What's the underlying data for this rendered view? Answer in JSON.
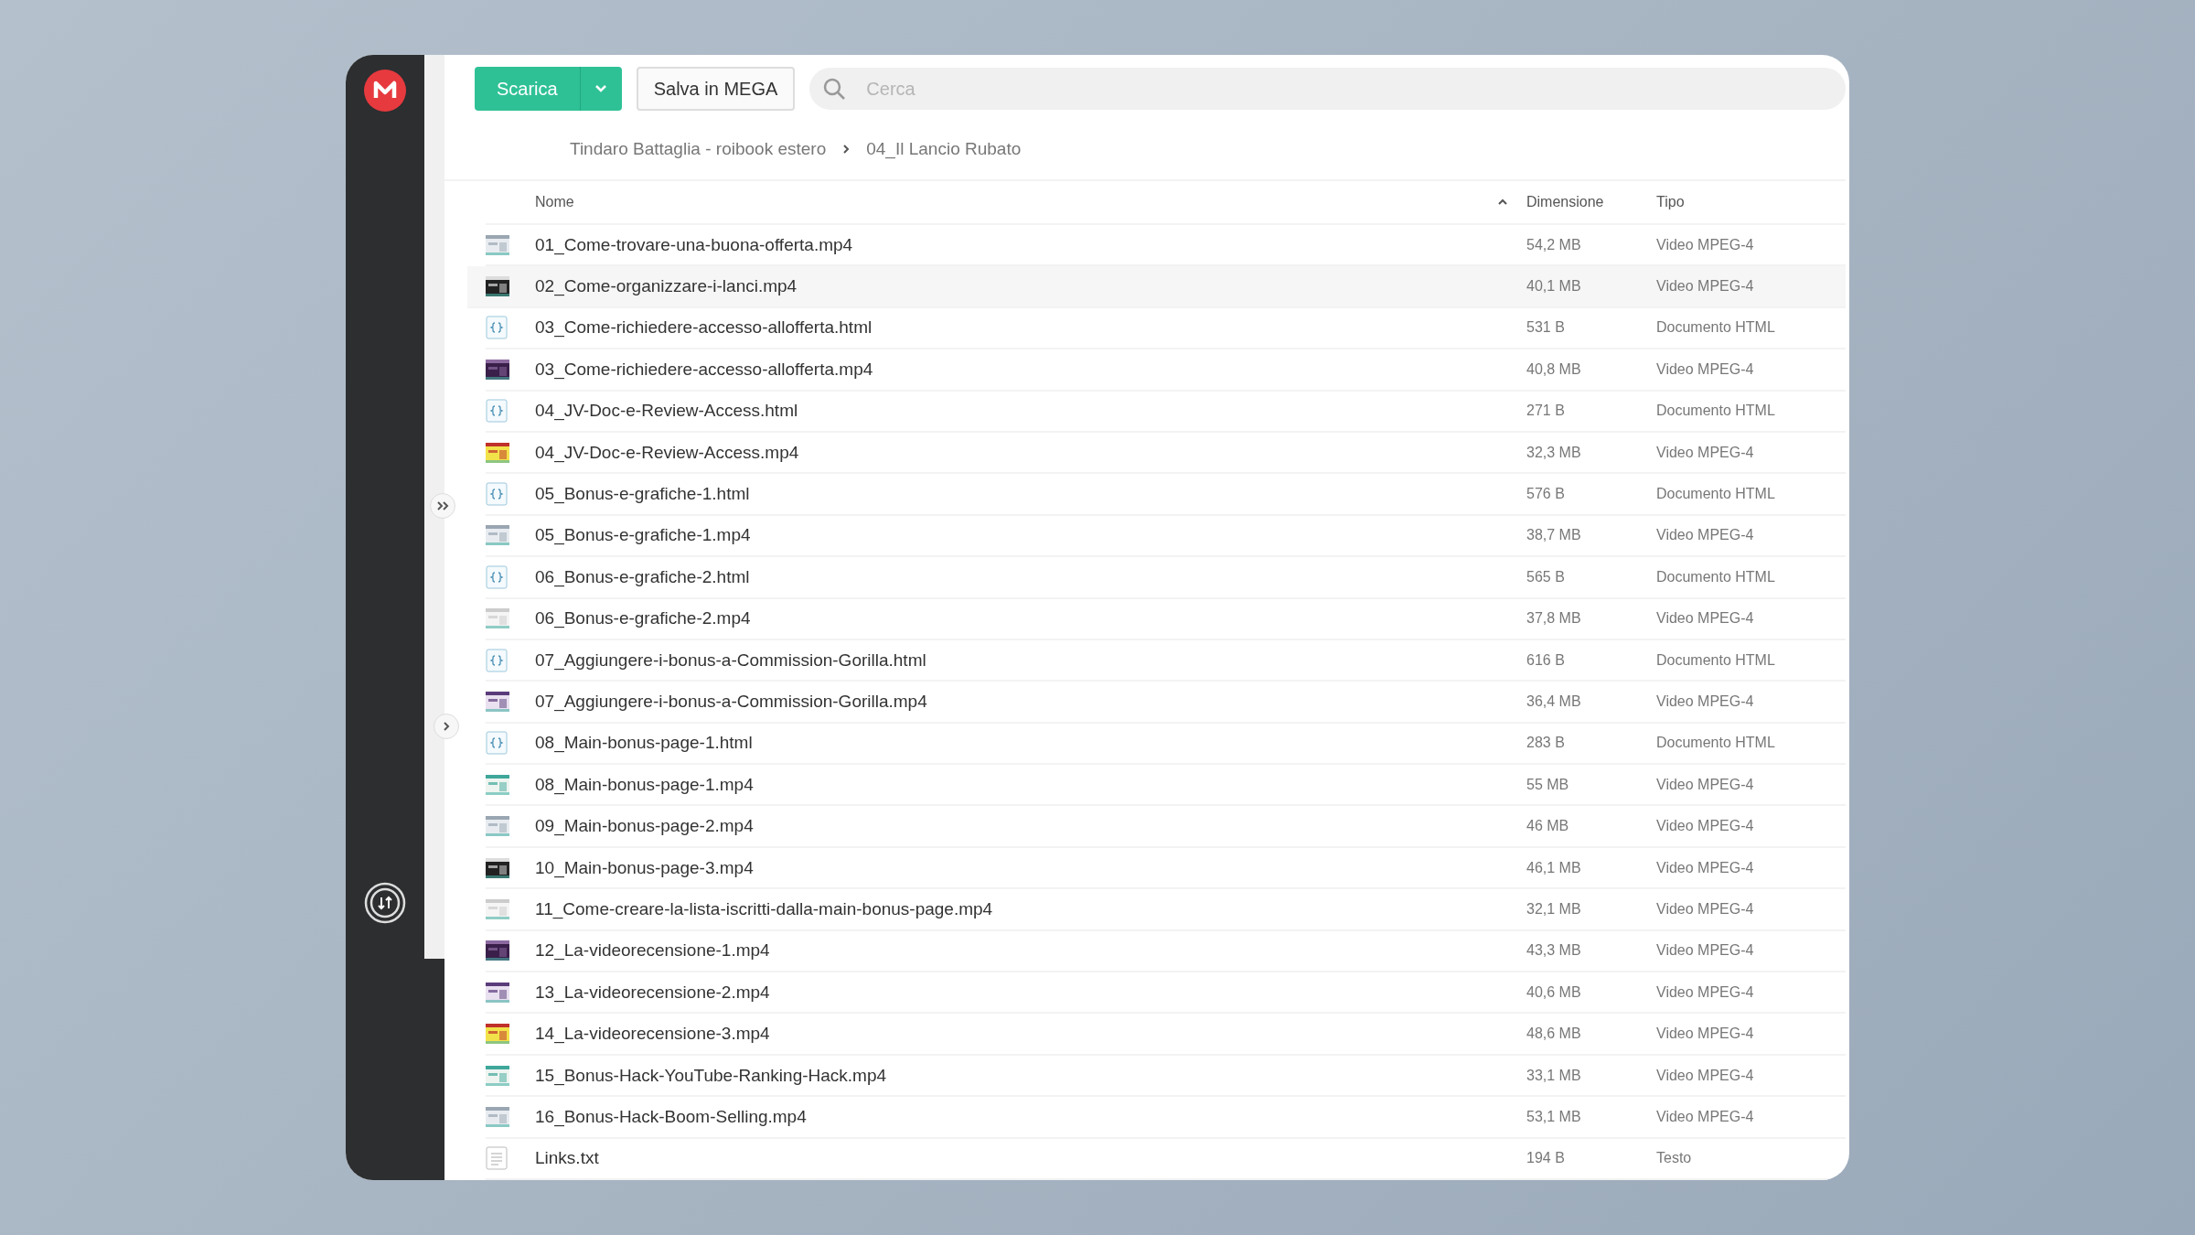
{
  "toolbar": {
    "download_button": "Scarica",
    "save_button": "Salva in MEGA",
    "search": {
      "placeholder": "Cerca"
    }
  },
  "breadcrumb": [
    "Tindaro Battaglia - roibook estero",
    "04_Il Lancio Rubato"
  ],
  "table": {
    "columns": [
      {
        "label": "Nome",
        "sorted": true
      },
      {
        "label": "Dimensione",
        "sorted": false
      },
      {
        "label": "Tipo",
        "sorted": false
      }
    ],
    "rows": [
      {
        "kind": "video",
        "name": "01_Come-trovare-una-buona-offerta.mp4",
        "size": "54,2 MB",
        "type": "Video MPEG-4",
        "selected": false
      },
      {
        "kind": "video",
        "name": "02_Come-organizzare-i-lanci.mp4",
        "size": "40,1 MB",
        "type": "Video MPEG-4",
        "selected": true
      },
      {
        "kind": "html",
        "name": "03_Come-richiedere-accesso-allofferta.html",
        "size": "531 B",
        "type": "Documento HTML",
        "selected": false
      },
      {
        "kind": "video",
        "name": "03_Come-richiedere-accesso-allofferta.mp4",
        "size": "40,8 MB",
        "type": "Video MPEG-4",
        "selected": false
      },
      {
        "kind": "html",
        "name": "04_JV-Doc-e-Review-Access.html",
        "size": "271 B",
        "type": "Documento HTML",
        "selected": false
      },
      {
        "kind": "video",
        "name": "04_JV-Doc-e-Review-Access.mp4",
        "size": "32,3 MB",
        "type": "Video MPEG-4",
        "selected": false
      },
      {
        "kind": "html",
        "name": "05_Bonus-e-grafiche-1.html",
        "size": "576 B",
        "type": "Documento HTML",
        "selected": false
      },
      {
        "kind": "video",
        "name": "05_Bonus-e-grafiche-1.mp4",
        "size": "38,7 MB",
        "type": "Video MPEG-4",
        "selected": false
      },
      {
        "kind": "html",
        "name": "06_Bonus-e-grafiche-2.html",
        "size": "565 B",
        "type": "Documento HTML",
        "selected": false
      },
      {
        "kind": "video",
        "name": "06_Bonus-e-grafiche-2.mp4",
        "size": "37,8 MB",
        "type": "Video MPEG-4",
        "selected": false
      },
      {
        "kind": "html",
        "name": "07_Aggiungere-i-bonus-a-Commission-Gorilla.html",
        "size": "616 B",
        "type": "Documento HTML",
        "selected": false
      },
      {
        "kind": "video",
        "name": "07_Aggiungere-i-bonus-a-Commission-Gorilla.mp4",
        "size": "36,4 MB",
        "type": "Video MPEG-4",
        "selected": false
      },
      {
        "kind": "html",
        "name": "08_Main-bonus-page-1.html",
        "size": "283 B",
        "type": "Documento HTML",
        "selected": false
      },
      {
        "kind": "video",
        "name": "08_Main-bonus-page-1.mp4",
        "size": "55 MB",
        "type": "Video MPEG-4",
        "selected": false
      },
      {
        "kind": "video",
        "name": "09_Main-bonus-page-2.mp4",
        "size": "46 MB",
        "type": "Video MPEG-4",
        "selected": false
      },
      {
        "kind": "video",
        "name": "10_Main-bonus-page-3.mp4",
        "size": "46,1 MB",
        "type": "Video MPEG-4",
        "selected": false
      },
      {
        "kind": "video",
        "name": "11_Come-creare-la-lista-iscritti-dalla-main-bonus-page.mp4",
        "size": "32,1 MB",
        "type": "Video MPEG-4",
        "selected": false
      },
      {
        "kind": "video",
        "name": "12_La-videorecensione-1.mp4",
        "size": "43,3 MB",
        "type": "Video MPEG-4",
        "selected": false
      },
      {
        "kind": "video",
        "name": "13_La-videorecensione-2.mp4",
        "size": "40,6 MB",
        "type": "Video MPEG-4",
        "selected": false
      },
      {
        "kind": "video",
        "name": "14_La-videorecensione-3.mp4",
        "size": "48,6 MB",
        "type": "Video MPEG-4",
        "selected": false
      },
      {
        "kind": "video",
        "name": "15_Bonus-Hack-YouTube-Ranking-Hack.mp4",
        "size": "33,1 MB",
        "type": "Video MPEG-4",
        "selected": false
      },
      {
        "kind": "video",
        "name": "16_Bonus-Hack-Boom-Selling.mp4",
        "size": "53,1 MB",
        "type": "Video MPEG-4",
        "selected": false
      },
      {
        "kind": "text",
        "name": "Links.txt",
        "size": "194 B",
        "type": "Testo",
        "selected": false
      }
    ]
  }
}
